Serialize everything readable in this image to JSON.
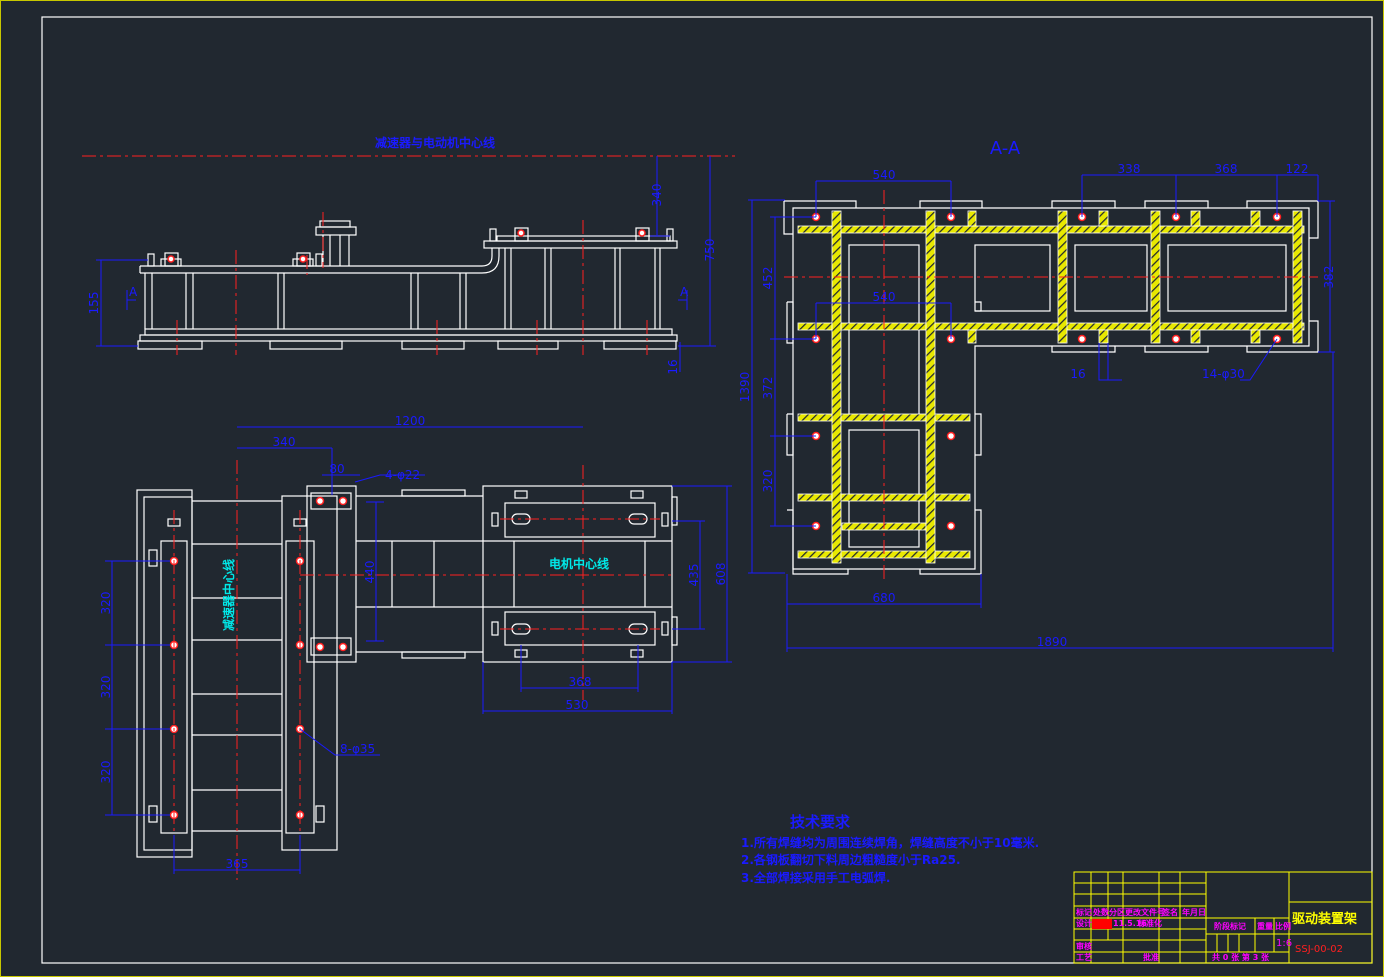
{
  "colors": {
    "background": "#212830",
    "outline": "#ffffff",
    "centerline": "#ff2020",
    "dimension": "#1a1aff",
    "label": "#00e8e8",
    "hatch": "#ffff00",
    "title_text": "#ff00ff"
  },
  "side_view": {
    "centerline_label": "减速器与电动机中心线",
    "section_mark": "A",
    "dims": {
      "d340": "340",
      "d750": "750",
      "d155": "155",
      "d16": "16"
    }
  },
  "plan_view": {
    "reducer_label": "减速器中心线",
    "motor_label": "电机中心线",
    "dims": {
      "d1200": "1200",
      "d340": "340",
      "d80": "80",
      "holes_small": "4-φ22",
      "d440": "440",
      "d435": "435",
      "d608": "608",
      "d368": "368",
      "d530": "530",
      "d320a": "320",
      "d320b": "320",
      "d320c": "320",
      "d365": "365",
      "holes_large": "8-φ35"
    }
  },
  "section_view": {
    "title": "A-A",
    "dims": {
      "d540a": "540",
      "d338": "338",
      "d368": "368",
      "d122": "122",
      "d1390": "1390",
      "d452": "452",
      "d372": "372",
      "d320": "320",
      "d540b": "540",
      "d680": "680",
      "d1890": "1890",
      "d382": "382",
      "d16": "16",
      "holes": "14-φ30"
    }
  },
  "notes": {
    "title": "技术要求",
    "items": [
      "1.所有焊缝均为周围连续焊角，焊缝高度不小于10毫米.",
      "2.各钢板翻切下料周边粗糙度小于Ra25.",
      "3.全部焊接采用手工电弧焊."
    ]
  },
  "title_block": {
    "headers": [
      "标记",
      "处数",
      "分区",
      "更改文件号",
      "签名",
      "年月日"
    ],
    "design": "设计",
    "date": "11.5.16",
    "standardize": "标准化",
    "review": "审核",
    "process": "工艺",
    "approve": "批准",
    "stage_mark": "阶段标记",
    "weight": "重量",
    "scale_label": "比例",
    "scale": "1:6",
    "sheets": "共 0 张 第 3 张",
    "drawing_title": "驱动装置架",
    "drawing_number": "SSJ-00-02"
  }
}
